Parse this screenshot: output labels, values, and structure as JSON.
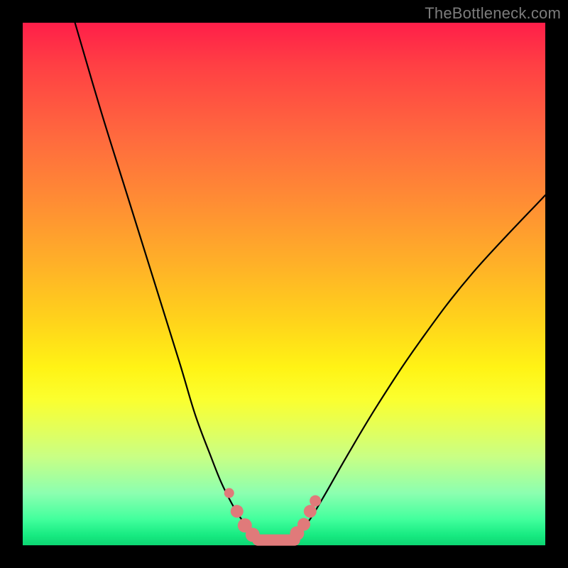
{
  "watermark": "TheBottleneck.com",
  "chart_data": {
    "type": "line",
    "title": "",
    "xlabel": "",
    "ylabel": "",
    "xlim": [
      0,
      100
    ],
    "ylim": [
      0,
      100
    ],
    "series": [
      {
        "name": "left-curve",
        "x": [
          10,
          15,
          20,
          25,
          30,
          33,
          36,
          38,
          40,
          41.5,
          43,
          44,
          45
        ],
        "y": [
          100,
          83,
          67,
          51,
          35,
          25,
          17,
          12,
          8,
          5.5,
          3.5,
          2.3,
          1.5
        ]
      },
      {
        "name": "right-curve",
        "x": [
          52,
          53,
          55,
          58,
          62,
          68,
          76,
          86,
          100
        ],
        "y": [
          1.5,
          2.5,
          5,
          10,
          17,
          27,
          39,
          52,
          67
        ]
      },
      {
        "name": "valley-floor",
        "x": [
          45,
          52
        ],
        "y": [
          1.0,
          1.0
        ]
      }
    ],
    "markers": {
      "name": "highlight-dots",
      "color": "#e07a7a",
      "points": [
        {
          "x": 39.5,
          "y": 10.0,
          "r": 7
        },
        {
          "x": 41.0,
          "y": 6.5,
          "r": 9
        },
        {
          "x": 42.5,
          "y": 3.8,
          "r": 10
        },
        {
          "x": 44.0,
          "y": 2.0,
          "r": 10
        },
        {
          "x": 52.5,
          "y": 2.3,
          "r": 10
        },
        {
          "x": 53.8,
          "y": 4.0,
          "r": 9
        },
        {
          "x": 55.0,
          "y": 6.5,
          "r": 9
        },
        {
          "x": 56.0,
          "y": 8.5,
          "r": 8
        }
      ]
    }
  }
}
